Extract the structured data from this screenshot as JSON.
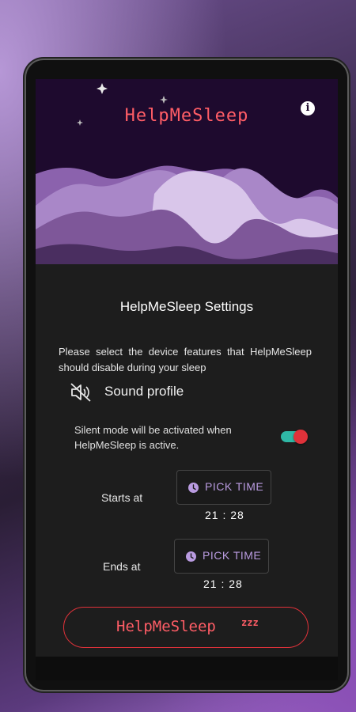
{
  "app": {
    "title": "HelpMeSleep",
    "info_icon": "info-icon",
    "brand_color": "#ff5d66"
  },
  "settings": {
    "title": "HelpMeSleep Settings",
    "description": "Please select the device features that HelpMeSleep should disable during your sleep"
  },
  "sound_profile": {
    "icon": "volume-off-icon",
    "label": "Sound profile",
    "silent_text": "Silent mode will be activated when HelpMeSleep is active.",
    "toggle_on": true
  },
  "schedule": {
    "start": {
      "label": "Starts at",
      "button_label": "PICK TIME",
      "time": "21 : 28"
    },
    "end": {
      "label": "Ends at",
      "button_label": "PICK TIME",
      "time": "21 : 28"
    }
  },
  "cta": {
    "label": "HelpMeSleep",
    "suffix": "zzz"
  },
  "colors": {
    "accent_purple": "#b99be0",
    "toggle_track": "#2fb8a6",
    "toggle_thumb": "#e0323a"
  }
}
